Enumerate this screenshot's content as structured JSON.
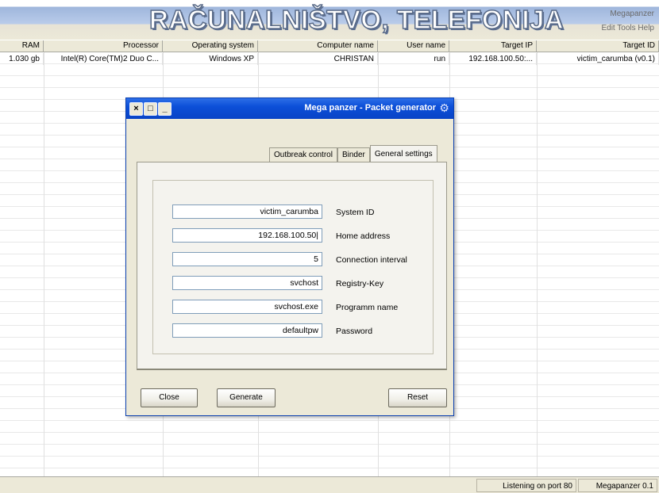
{
  "banner": {
    "text": "RAČUNALNIŠTVO, TELEFONIJA",
    "mini_line1": "Megapanzer",
    "mini_line2": "Edit Tools Help"
  },
  "grid": {
    "columns": [
      "RAM",
      "Processor",
      "Operating system",
      "Computer name",
      "User name",
      "Target IP",
      "Target ID"
    ],
    "rows": [
      [
        "1.030 gb",
        "Intel(R) Core(TM)2 Duo C...",
        "Windows XP",
        "CHRISTAN",
        "run",
        "192.168.100.50:...",
        "victim_carumba (v0.1)"
      ]
    ]
  },
  "status": {
    "app_version": "Megapanzer 0.1",
    "message": "Listening on port 80"
  },
  "dialog": {
    "title": "Mega panzer - Packet generator",
    "icon": "gear-icon",
    "tabs": {
      "general": "General settings",
      "binder": "Binder",
      "outbreak": "Outbreak control"
    },
    "fields": {
      "system_id": {
        "label": "System ID",
        "value": "victim_carumba"
      },
      "home_address": {
        "label": "Home address",
        "value": "192.168.100.50|"
      },
      "connection_interval": {
        "label": "Connection interval",
        "value": "5"
      },
      "registry_key": {
        "label": "Registry-Key",
        "value": "svchost"
      },
      "program_name": {
        "label": "Programm name",
        "value": "svchost.exe"
      },
      "password": {
        "label": "Password",
        "value": "defaultpw"
      }
    },
    "buttons": {
      "reset": "Reset",
      "generate": "Generate",
      "close": "Close"
    },
    "window_buttons": {
      "close": "×",
      "maximize": "□",
      "minimize": "_"
    }
  }
}
